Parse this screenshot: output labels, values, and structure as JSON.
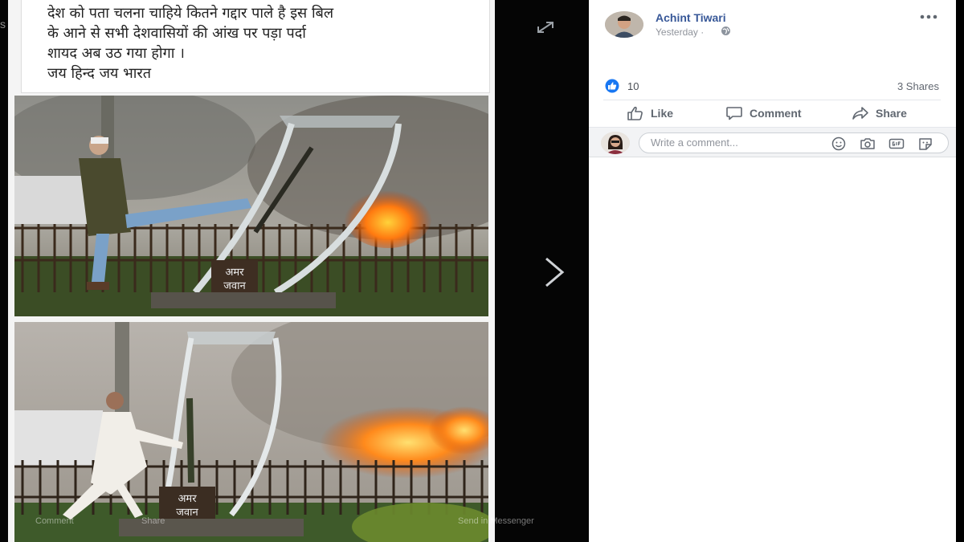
{
  "viewer": {
    "caption_lines": [
      "देश को पता चलना चाहिये कितने गद्दार पाले है इस बिल",
      "के आने से सभी देशवासियों की आंख पर पड़ा पर्दा",
      "शायद अब उठ गया होगा ।",
      "जय हिन्द जय भारत"
    ],
    "photo_sign_lines": [
      "अमर",
      "जवान"
    ],
    "ghost_top_text": "s from",
    "ghost_bar": {
      "comment": "Comment",
      "share": "Share",
      "messenger": "Send in Messenger"
    }
  },
  "post": {
    "author": "Achint Tiwari",
    "timestamp": "Yesterday ·",
    "reaction_count": "10",
    "shares": "3 Shares",
    "actions": {
      "like": "Like",
      "comment": "Comment",
      "share": "Share"
    },
    "comment_placeholder": "Write a comment..."
  },
  "colors": {
    "link": "#385898",
    "like_blue": "#1877f2",
    "panel_bg": "#ffffff",
    "comment_bar_bg": "#f2f3f5"
  },
  "icons": [
    "expand-icon",
    "next-arrow-icon",
    "globe-icon",
    "more-icon",
    "like-reaction-icon",
    "like-icon",
    "comment-icon",
    "share-icon",
    "emoji-icon",
    "camera-icon",
    "gif-icon",
    "sticker-icon"
  ]
}
